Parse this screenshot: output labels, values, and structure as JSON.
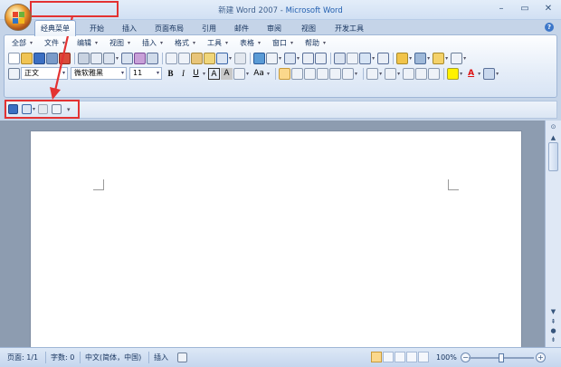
{
  "window": {
    "title_doc": "新建 Word 2007",
    "title_sep": " - ",
    "title_app": "Microsoft Word",
    "controls": {
      "minimize": "–",
      "maximize": "▭",
      "close": "✕"
    }
  },
  "ribbon_tabs": [
    "经典菜单",
    "开始",
    "插入",
    "页面布局",
    "引用",
    "邮件",
    "审阅",
    "视图",
    "开发工具"
  ],
  "active_tab": "经典菜单",
  "help_glyph": "?",
  "classic_menu": [
    "全部",
    "文件",
    "编辑",
    "视图",
    "插入",
    "格式",
    "工具",
    "表格",
    "窗口",
    "帮助"
  ],
  "formatting": {
    "style": "正文",
    "font": "微软雅黑",
    "size": "11",
    "bold": "B",
    "italic": "I",
    "underline": "U",
    "char_border": "A",
    "char_shading": "A",
    "change_case": "Aa",
    "font_color": "A"
  },
  "quick_access": {
    "more": "▾"
  },
  "status": {
    "page": "页面: 1/1",
    "words": "字数: 0",
    "language": "中文(简体，中国)",
    "mode": "插入",
    "zoom": "100%",
    "zoom_out": "−",
    "zoom_in": "+"
  },
  "colors": {
    "annotation_red": "#e33232",
    "title_app_blue": "#2460b0"
  }
}
